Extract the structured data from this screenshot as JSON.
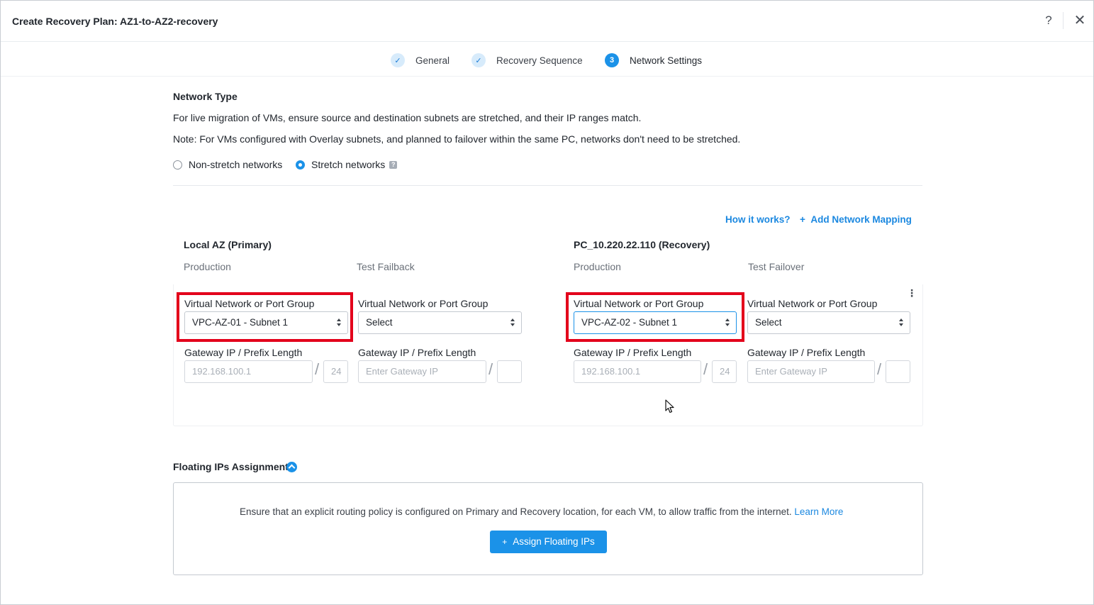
{
  "header": {
    "title": "Create Recovery Plan: AZ1-to-AZ2-recovery",
    "help_label": "?",
    "close_label": "✕"
  },
  "steps": [
    {
      "label": "General",
      "state": "done",
      "marker": "✓"
    },
    {
      "label": "Recovery Sequence",
      "state": "done",
      "marker": "✓"
    },
    {
      "label": "Network Settings",
      "state": "active",
      "marker": "3"
    }
  ],
  "network_type": {
    "title": "Network Type",
    "desc1": "For live migration of VMs, ensure source and destination subnets are stretched, and their IP ranges match.",
    "desc2": "Note: For VMs configured with Overlay subnets, and planned to failover within the same PC, networks don't need to be stretched.",
    "option_non_stretch": "Non-stretch networks",
    "option_stretch": "Stretch networks",
    "selected": "Stretch networks",
    "info_glyph": "?"
  },
  "links": {
    "how_it_works": "How it works?",
    "add_mapping": "Add Network Mapping",
    "add_mapping_icon": "+"
  },
  "primary": {
    "title": "Local AZ (Primary)",
    "col_production": "Production",
    "col_test": "Test Failback",
    "prod": {
      "vn_label": "Virtual Network or Port Group",
      "vn_value": "VPC-AZ-01 - Subnet 1",
      "gw_label": "Gateway IP / Prefix Length",
      "gw_value": "192.168.100.1",
      "prefix_value": "24"
    },
    "test": {
      "vn_label": "Virtual Network or Port Group",
      "vn_value": "Select",
      "gw_label": "Gateway IP / Prefix Length",
      "gw_placeholder": "Enter Gateway IP",
      "prefix_value": ""
    }
  },
  "recovery": {
    "title": "PC_10.220.22.110 (Recovery)",
    "col_production": "Production",
    "col_test": "Test Failover",
    "prod": {
      "vn_label": "Virtual Network or Port Group",
      "vn_value": "VPC-AZ-02 - Subnet 1",
      "gw_label": "Gateway IP / Prefix Length",
      "gw_value": "192.168.100.1",
      "prefix_value": "24"
    },
    "test": {
      "vn_label": "Virtual Network or Port Group",
      "vn_value": "Select",
      "gw_label": "Gateway IP / Prefix Length",
      "gw_placeholder": "Enter Gateway IP",
      "prefix_value": ""
    }
  },
  "kebab_glyph": "⋮",
  "slash_glyph": "/",
  "floating_ips": {
    "title": "Floating IPs Assignment",
    "notice": "Ensure that an explicit routing policy is configured on Primary and Recovery location, for each VM, to allow traffic from the internet.",
    "learn_more": "Learn More",
    "assign_button": "Assign Floating IPs",
    "assign_icon": "+"
  },
  "colors": {
    "accent": "#1b92e8",
    "highlight": "#e3001b"
  }
}
